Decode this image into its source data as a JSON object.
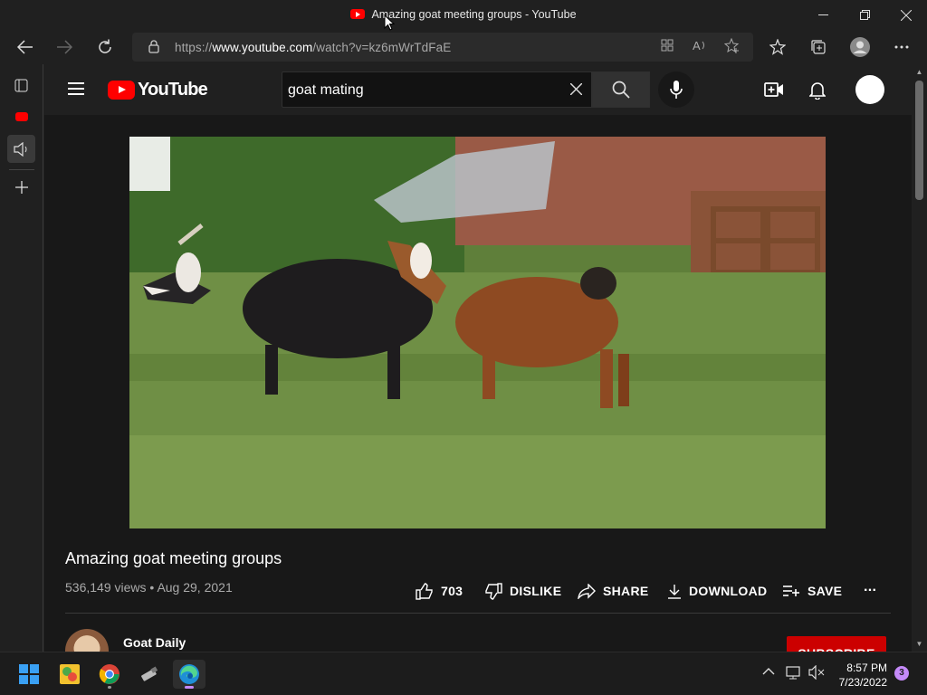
{
  "window": {
    "title": "Amazing goat meeting groups - YouTube",
    "controls": [
      "minimize",
      "restore",
      "close"
    ]
  },
  "browser": {
    "url_prefix": "https://",
    "url_domain": "www.youtube.com",
    "url_path": "/watch?v=kz6mWrTdFaE"
  },
  "youtube": {
    "logo_text": "YouTube",
    "search_query": "goat mating",
    "video": {
      "title": "Amazing goat meeting groups",
      "views": "536,149 views",
      "date": "Aug 29, 2021",
      "meta_separator": "•",
      "likes": "703",
      "dislike_label": "DISLIKE",
      "share_label": "SHARE",
      "download_label": "DOWNLOAD",
      "save_label": "SAVE",
      "more_label": "..."
    },
    "channel": {
      "name": "Goat Daily",
      "subscribe_label": "SUBSCRIBE"
    }
  },
  "taskbar": {
    "time": "8:57 PM",
    "date": "7/23/2022",
    "notification_count": "3"
  },
  "colors": {
    "youtube_red": "#ff0000",
    "subscribe_red": "#cc0000",
    "edge_accent": "#c58af9"
  }
}
